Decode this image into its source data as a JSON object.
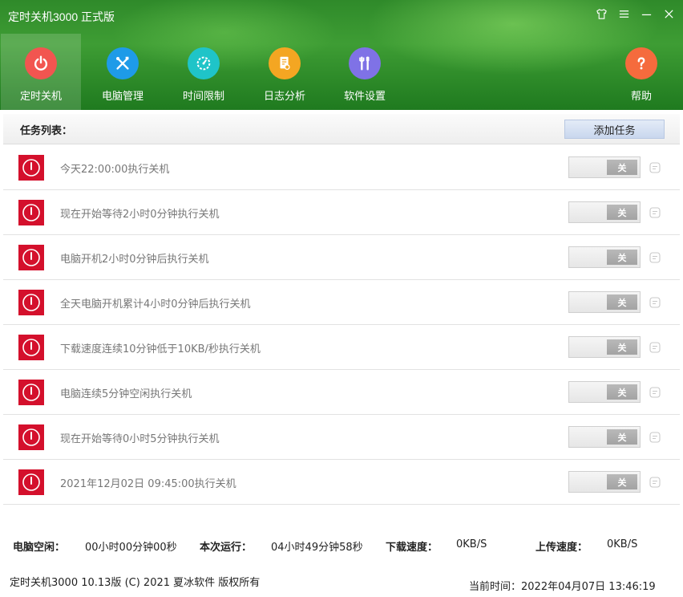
{
  "window": {
    "title": "定时关机3000 正式版"
  },
  "colors": {
    "header_green": "#3e9d34",
    "power_red": "#f25550",
    "tools_blue": "#1e9be8",
    "timer_teal": "#1fc4c8",
    "log_orange": "#f4a622",
    "settings_purple": "#7f72e6",
    "help_orange": "#f56b3d",
    "row_icon_red": "#d4102c"
  },
  "nav": [
    {
      "label": "定时关机",
      "icon": "power-icon",
      "active": true
    },
    {
      "label": "电脑管理",
      "icon": "tools-icon",
      "active": false
    },
    {
      "label": "时间限制",
      "icon": "timer-icon",
      "active": false
    },
    {
      "label": "日志分析",
      "icon": "log-icon",
      "active": false
    },
    {
      "label": "软件设置",
      "icon": "settings-icon",
      "active": false
    },
    {
      "label": "帮助",
      "icon": "help-icon",
      "active": false
    }
  ],
  "tasks": {
    "title": "任务列表：",
    "add_label": "添加任务",
    "toggle_label": "关",
    "items": [
      {
        "text": "今天22:00:00执行关机"
      },
      {
        "text": "现在开始等待2小时0分钟执行关机"
      },
      {
        "text": "电脑开机2小时0分钟后执行关机"
      },
      {
        "text": "全天电脑开机累计4小时0分钟后执行关机"
      },
      {
        "text": "下载速度连续10分钟低于10KB/秒执行关机"
      },
      {
        "text": "电脑连续5分钟空闲执行关机"
      },
      {
        "text": "现在开始等待0小时5分钟执行关机"
      },
      {
        "text": "2021年12月02日 09:45:00执行关机"
      }
    ]
  },
  "status": {
    "idle_label": "电脑空闲：",
    "idle_value": "00小时00分钟00秒",
    "run_label": "本次运行：",
    "run_value": "04小时49分钟58秒",
    "down_label": "下载速度：",
    "down_value": "0KB/S",
    "up_label": "上传速度：",
    "up_value": "0KB/S"
  },
  "footer": {
    "copyright": "定时关机3000 10.13版 (C) 2021  夏冰软件 版权所有",
    "current_time": "当前时间：2022年04月07日 13:46:19"
  }
}
